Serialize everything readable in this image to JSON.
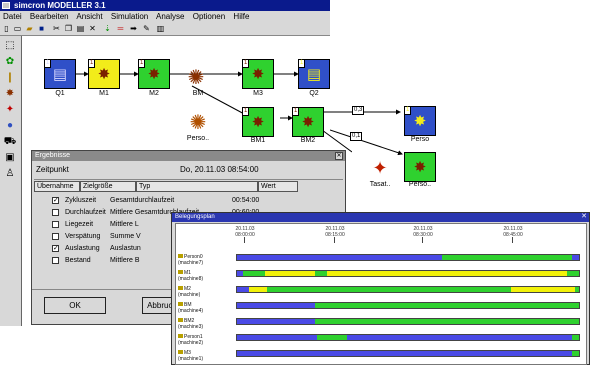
{
  "app": {
    "title": "simcron MODELLER 3.1",
    "menu": [
      "Datei",
      "Bearbeiten",
      "Ansicht",
      "Simulation",
      "Analyse",
      "Optionen",
      "Hilfe"
    ]
  },
  "model": {
    "nodes": [
      {
        "id": "q1",
        "label": "Q1",
        "num": "1"
      },
      {
        "id": "m1",
        "label": "M1",
        "num": "1"
      },
      {
        "id": "m2",
        "label": "M2",
        "num": "1"
      },
      {
        "id": "bm",
        "label": "BM",
        "num": ""
      },
      {
        "id": "m3",
        "label": "M3",
        "num": "1"
      },
      {
        "id": "q2",
        "label": "Q2",
        "num": "1"
      },
      {
        "id": "perso1",
        "label": "Perso..",
        "num": ""
      },
      {
        "id": "bm1",
        "label": "BM1",
        "num": "1"
      },
      {
        "id": "bm2",
        "label": "BM2",
        "num": "1"
      },
      {
        "id": "perso2",
        "label": "Perso",
        "num": "1"
      },
      {
        "id": "tasat",
        "label": "Tasat..",
        "num": ""
      },
      {
        "id": "perso3",
        "label": "Perso..",
        "num": ""
      }
    ],
    "conn_labels": [
      "0,3",
      "0,1"
    ]
  },
  "dialog": {
    "title": "Ergebnisse",
    "zeitpunkt_label": "Zeitpunkt",
    "zeitpunkt_value": "Do, 20.11.03 08:54:00",
    "headers": [
      "Übernahme",
      "Zielgröße",
      "Typ",
      "Wert"
    ],
    "rows": [
      {
        "checked": true,
        "name": "Zykluszeit",
        "typ": "Gesamtdurchlaufzeit",
        "wert": "00:54:00"
      },
      {
        "checked": false,
        "name": "Durchlaufzeit",
        "typ": "Mittlere Gesamtdurchlaufzeit",
        "wert": "00:60:00"
      },
      {
        "checked": false,
        "name": "Liegezeit",
        "typ": "Mittlere L",
        "wert": ""
      },
      {
        "checked": false,
        "name": "Verspätung",
        "typ": "Summe V",
        "wert": ""
      },
      {
        "checked": true,
        "name": "Auslastung",
        "typ": "Auslastun",
        "wert": ""
      },
      {
        "checked": false,
        "name": "Bestand",
        "typ": "Mittlere B",
        "wert": ""
      }
    ],
    "ok_label": "OK",
    "cancel_label": "Abbruch"
  },
  "gantt": {
    "title": "Belegungsplan",
    "times": [
      {
        "date": "20.11.03",
        "time": "08:00:00"
      },
      {
        "date": "20.11.03",
        "time": "08:15:00"
      },
      {
        "date": "20.11.03",
        "time": "08:30:00"
      },
      {
        "date": "20.11.03",
        "time": "08:45:00"
      }
    ],
    "rows": [
      {
        "name": "Person0",
        "sub": "(machine7)"
      },
      {
        "name": "M1",
        "sub": "(machine8)"
      },
      {
        "name": "M2",
        "sub": "(machine)"
      },
      {
        "name": "BM",
        "sub": "(machine4)"
      },
      {
        "name": "BM2",
        "sub": "(machine3)"
      },
      {
        "name": "Person1",
        "sub": "(machine2)"
      },
      {
        "name": "M3",
        "sub": "(machine1)"
      }
    ],
    "colors": {
      "busy": "#2fd12f",
      "idle": "#4a4ae6",
      "setup": "#f2f20a"
    }
  }
}
